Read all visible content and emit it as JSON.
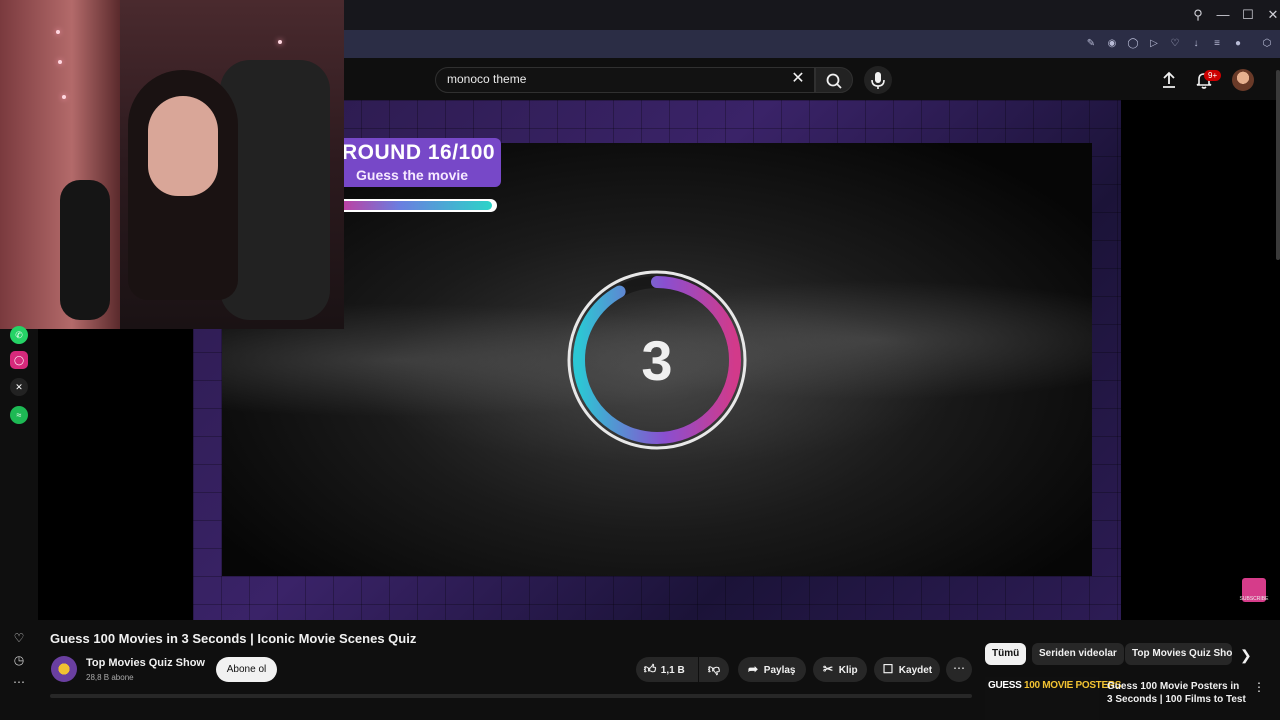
{
  "search": {
    "query": "monoco theme"
  },
  "header": {
    "notification_badge": "9+"
  },
  "video": {
    "round_label": "ROUND 16/100",
    "round_sub": "Guess the movie",
    "countdown": "3",
    "round_progress_fraction": 0.98,
    "timer_progress_fraction": 0.92,
    "subscribe_badge": "SUBSCRIBE"
  },
  "details": {
    "title": "Guess 100 Movies in 3 Seconds | Iconic Movie Scenes Quiz",
    "channel_name": "Top Movies Quiz Show",
    "channel_subs": "28,8 B abone",
    "subscribe_label": "Abone ol",
    "like_count": "1,1 B",
    "share_label": "Paylaş",
    "clip_label": "Klip",
    "save_label": "Kaydet"
  },
  "recommendations": {
    "chips": [
      "Tümü",
      "Seriden videolar",
      "Top Movies Quiz Sho"
    ],
    "first": {
      "thumb_text_a": "GUESS",
      "thumb_text_b": "100 MOVIE POSTERS",
      "title": "Guess 100 Movie Posters in 3 Seconds | 100 Films to Test"
    }
  },
  "icons": {
    "search": "search-icon",
    "mic": "mic-icon",
    "upload": "upload-icon",
    "bell": "bell-icon",
    "social": [
      "whatsapp-icon",
      "instagram-icon",
      "x-icon",
      "spotify-icon"
    ]
  },
  "colors": {
    "accent": "#7748c8",
    "brand_red": "#cc0000",
    "timer_teal": "#2cc7d4",
    "timer_pink": "#c43b9d"
  }
}
